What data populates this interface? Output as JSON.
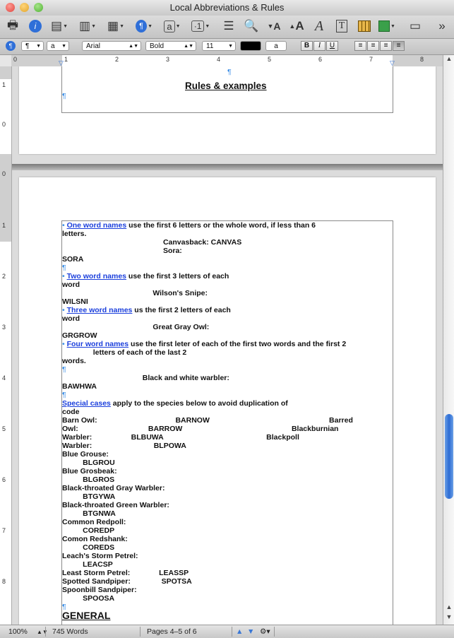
{
  "window": {
    "title": "Local Abbreviations & Rules"
  },
  "toolbar": {
    "icons": [
      "print-icon",
      "info-icon",
      "sidebar-icon",
      "columns-icon",
      "gallery-icon",
      "paragraph-marks-icon",
      "text-box-icon",
      "insert-icon",
      "list-icon",
      "zoom-icon",
      "font-decrease-icon",
      "font-increase-icon",
      "font-style-icon",
      "text-frame-icon",
      "table-icon",
      "shapes-icon",
      "media-icon",
      "overflow-icon"
    ]
  },
  "format_bar": {
    "style1": "¶",
    "style2": "a",
    "font": "Arial",
    "weight": "Bold",
    "size": "11",
    "highlight": "a",
    "bold": "B",
    "italic": "I",
    "underline": "U"
  },
  "ruler": {
    "numbers": [
      "0",
      "1",
      "2",
      "3",
      "4",
      "5",
      "6",
      "7",
      "8"
    ],
    "vnumbers": [
      "1",
      "0",
      "0",
      "1",
      "2",
      "3",
      "4",
      "5",
      "6",
      "7",
      "8"
    ]
  },
  "doc": {
    "heading": "Rules & examples",
    "pilcrow": "¶",
    "lines": [
      {
        "parts": [
          {
            "t": "• ",
            "c": "pil"
          },
          {
            "t": "One word names",
            "c": "blue"
          },
          {
            "t": " use the first 6 letters or the whole word, if less than 6 "
          }
        ]
      },
      {
        "parts": [
          {
            "t": "letters."
          }
        ]
      },
      {
        "parts": [
          {
            "t": "                                                 Canvasback: CANVAS"
          }
        ]
      },
      {
        "parts": [
          {
            "t": "                                                 Sora:"
          }
        ]
      },
      {
        "parts": [
          {
            "t": "SORA"
          }
        ]
      },
      {
        "parts": [
          {
            "t": "¶",
            "c": "pil"
          }
        ]
      },
      {
        "parts": [
          {
            "t": "• ",
            "c": "pil"
          },
          {
            "t": "Two word names",
            "c": "blue"
          },
          {
            "t": " use the first 3 letters of each "
          }
        ]
      },
      {
        "parts": [
          {
            "t": "word"
          }
        ]
      },
      {
        "parts": [
          {
            "t": "                                            Wilson's Snipe:"
          }
        ]
      },
      {
        "parts": [
          {
            "t": "WILSNI"
          }
        ]
      },
      {
        "parts": [
          {
            "t": "• ",
            "c": "pil"
          },
          {
            "t": "Three word names",
            "c": "blue"
          },
          {
            "t": " us the first 2 letters of each "
          }
        ]
      },
      {
        "parts": [
          {
            "t": "word"
          }
        ]
      },
      {
        "parts": [
          {
            "t": "                                            Great Gray Owl:"
          }
        ]
      },
      {
        "parts": [
          {
            "t": "GRGROW"
          }
        ]
      },
      {
        "parts": [
          {
            "t": "• ",
            "c": "pil"
          },
          {
            "t": "Four word names",
            "c": "blue"
          },
          {
            "t": " use the first leter of each of the first two words and the first 2 "
          }
        ]
      },
      {
        "parts": [
          {
            "t": "               letters of each of the last 2 "
          }
        ]
      },
      {
        "parts": [
          {
            "t": "words."
          }
        ]
      },
      {
        "parts": [
          {
            "t": "¶",
            "c": "pil"
          }
        ]
      },
      {
        "parts": [
          {
            "t": "                                       Black and white warbler:"
          }
        ]
      },
      {
        "parts": [
          {
            "t": "BAWHWA"
          }
        ]
      },
      {
        "parts": [
          {
            "t": "¶",
            "c": "pil"
          }
        ]
      },
      {
        "parts": [
          {
            "t": "Special cases",
            "c": "blue"
          },
          {
            "t": " apply to the species below to avoid duplication of "
          }
        ]
      },
      {
        "parts": [
          {
            "t": "code"
          }
        ]
      },
      {
        "parts": [
          {
            "t": "Barn Owl:                                      BARNOW                                                          Barred "
          }
        ]
      },
      {
        "parts": [
          {
            "t": "Owl:                                  BARROW                                                     Blackburnian "
          }
        ]
      },
      {
        "parts": [
          {
            "t": "Warbler:                   BLBUWA                                                  Blackpoll "
          }
        ]
      },
      {
        "parts": [
          {
            "t": "Warbler:                              BLPOWA"
          }
        ]
      },
      {
        "parts": [
          {
            "t": "Blue Grouse:"
          }
        ]
      },
      {
        "parts": [
          {
            "t": "          BLGROU"
          }
        ]
      },
      {
        "parts": [
          {
            "t": "Blue Grosbeak:"
          }
        ]
      },
      {
        "parts": [
          {
            "t": "          BLGROS"
          }
        ]
      },
      {
        "parts": [
          {
            "t": "Black-throated Gray Warbler:"
          }
        ]
      },
      {
        "parts": [
          {
            "t": "          BTGYWA"
          }
        ]
      },
      {
        "parts": [
          {
            "t": "Black-throated Green Warbler:"
          }
        ]
      },
      {
        "parts": [
          {
            "t": "          BTGNWA"
          }
        ]
      },
      {
        "parts": [
          {
            "t": "Common Redpoll:"
          }
        ]
      },
      {
        "parts": [
          {
            "t": "          COREDP"
          }
        ]
      },
      {
        "parts": [
          {
            "t": "Comon Redshank:"
          }
        ]
      },
      {
        "parts": [
          {
            "t": "          COREDS"
          }
        ]
      },
      {
        "parts": [
          {
            "t": "Leach's Storm Petrel:"
          }
        ]
      },
      {
        "parts": [
          {
            "t": "          LEACSP"
          }
        ]
      },
      {
        "parts": [
          {
            "t": "Least Storm Petrel:              LEASSP"
          }
        ]
      },
      {
        "parts": [
          {
            "t": "Spotted Sandpiper:               SPOTSA"
          }
        ]
      },
      {
        "parts": [
          {
            "t": "Spoonbill Sandpiper:"
          }
        ]
      },
      {
        "parts": [
          {
            "t": "          SPOOSA"
          }
        ]
      },
      {
        "parts": [
          {
            "t": "¶",
            "c": "pil"
          }
        ]
      }
    ],
    "general": "GENERAL"
  },
  "status": {
    "zoom": "100%",
    "words": "745 Words",
    "pages": "Pages 4–5 of 6"
  }
}
